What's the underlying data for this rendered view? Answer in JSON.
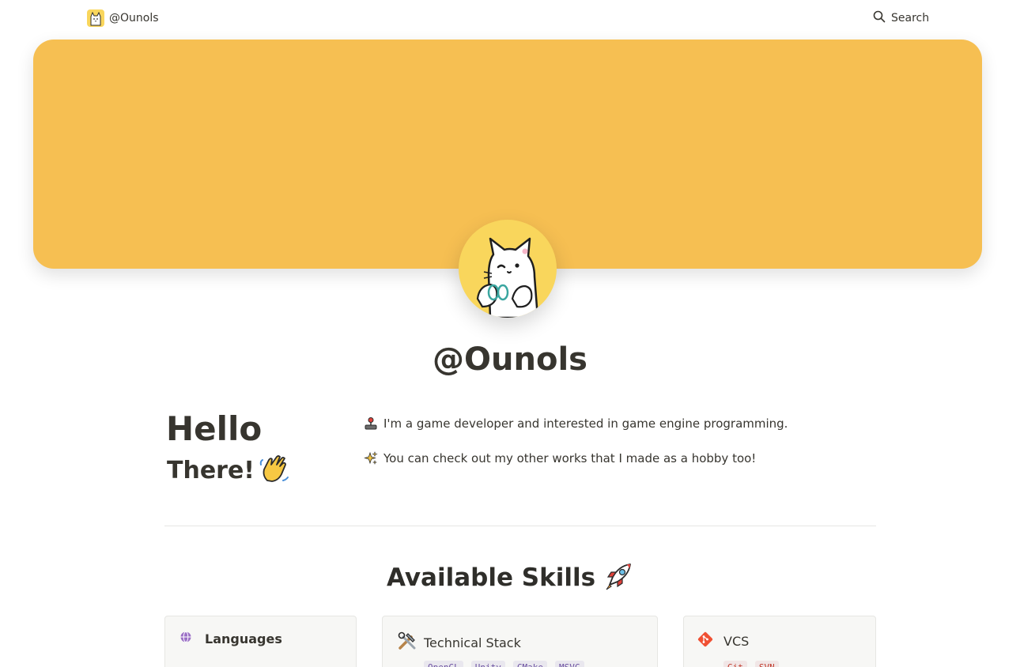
{
  "nav": {
    "brand_name": "@Ounols",
    "search_label": "Search"
  },
  "page": {
    "title": "@Ounols"
  },
  "intro": {
    "hello": "Hello",
    "there": "There!",
    "bio": [
      {
        "icon": "joystick-icon",
        "text": "I'm a game developer and interested in game engine programming."
      },
      {
        "icon": "sparkles-icon",
        "text": "You can check out my other works that I made as a hobby too!"
      }
    ]
  },
  "skills": {
    "heading": "Available Skills",
    "cards": [
      {
        "title": "Languages",
        "icon": "globe-icon",
        "tags": []
      },
      {
        "title": "Technical Stack",
        "icon": "hammer-wrench-icon",
        "tags": [
          "OpenGL",
          "Unity",
          "CMake",
          "MSVC"
        ]
      },
      {
        "title": "VCS",
        "icon": "git-icon",
        "tags": [
          "Git",
          "SVN"
        ]
      }
    ]
  },
  "colors": {
    "cover": "#f6bf52",
    "avatar_bg": "#f9d65c",
    "text": "#37352f"
  }
}
